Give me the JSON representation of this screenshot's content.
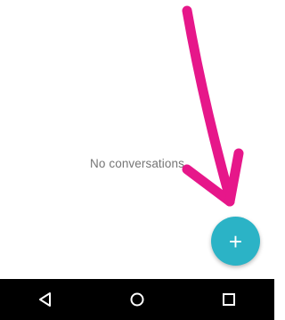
{
  "main": {
    "empty_message": "No conversations"
  },
  "fab": {
    "icon": "plus-icon",
    "glyph": "+"
  },
  "colors": {
    "fab": "#2bb3c6",
    "arrow": "#e6178a",
    "navbar": "#000000",
    "empty_text": "#757575"
  },
  "navbar": {
    "buttons": [
      "back-icon",
      "home-icon",
      "recents-icon"
    ]
  }
}
